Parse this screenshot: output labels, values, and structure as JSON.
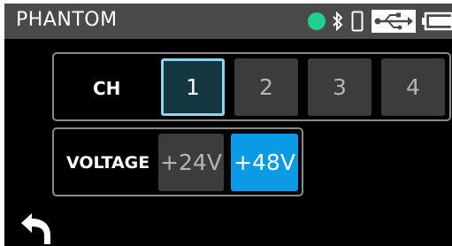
{
  "header": {
    "title": "PHANTOM",
    "status_icons": [
      "connection-status-dot-icon",
      "bluetooth-icon",
      "phone-icon",
      "usb-icon",
      "battery-icon"
    ],
    "status_dot_color": "#1fd18c"
  },
  "channel": {
    "label": "CH",
    "options": [
      "1",
      "2",
      "3",
      "4"
    ],
    "selected": "1"
  },
  "voltage": {
    "label": "VOLTAGE",
    "options": [
      "+24V",
      "+48V"
    ],
    "selected": "+48V"
  },
  "footer": {
    "back_icon": "back-arrow-icon"
  },
  "colors": {
    "titlebar_bg": "#4a4a4a",
    "selected_channel_border": "#8fd6ea",
    "active_voltage_bg": "#0a9ae6"
  }
}
